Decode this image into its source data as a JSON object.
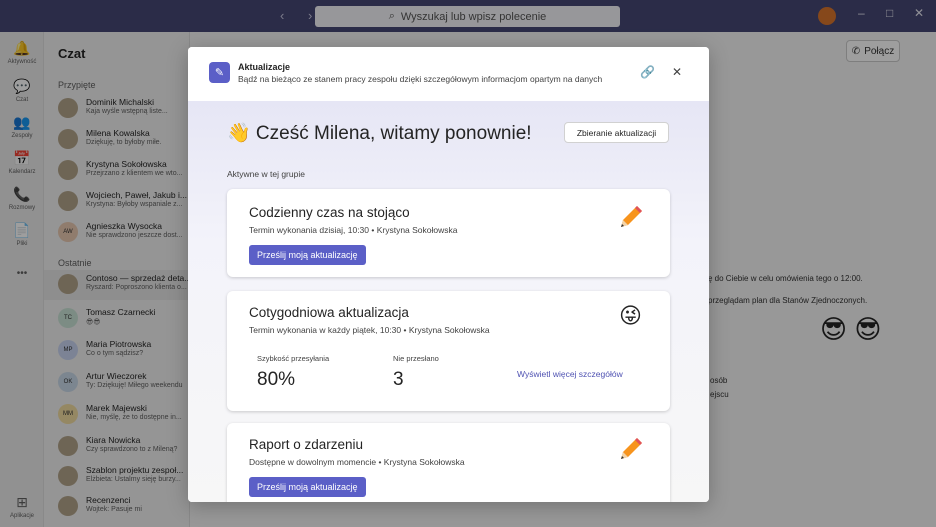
{
  "titlebar": {
    "nav_arrows": "‹ ›",
    "search_placeholder": "Wyszukaj lub wpisz polecenie",
    "minimize": "–",
    "maximize": "□",
    "close": "✕"
  },
  "rail": [
    {
      "icon": "bell-icon",
      "glyph": "🔔",
      "label": "Aktywność"
    },
    {
      "icon": "chat-icon",
      "glyph": "💬",
      "label": "Czat"
    },
    {
      "icon": "teams-icon",
      "glyph": "👥",
      "label": "Zespoły"
    },
    {
      "icon": "calendar-icon",
      "glyph": "📅",
      "label": "Kalendarz"
    },
    {
      "icon": "calls-icon",
      "glyph": "📞",
      "label": "Rozmowy"
    },
    {
      "icon": "files-icon",
      "glyph": "📄",
      "label": "Pliki"
    },
    {
      "icon": "more-icon",
      "glyph": "•••",
      "label": ""
    },
    {
      "icon": "apps-icon",
      "glyph": "⊞",
      "label": "Aplikacje"
    }
  ],
  "chatlist": {
    "title": "Czat",
    "pinned_label": "Przypięte",
    "recent_label": "Ostatnie",
    "pinned": [
      {
        "name": "Dominik Michalski",
        "preview": "Kaja wyśle wstępną liste...",
        "initials": ""
      },
      {
        "name": "Milena Kowalska",
        "preview": "Dziękuję, to byłoby miłe.",
        "initials": ""
      },
      {
        "name": "Krystyna Sokołowska",
        "preview": "Przejrzano z klientem we wto...",
        "initials": ""
      },
      {
        "name": "Wojciech, Paweł, Jakub i...",
        "preview": "Krystyna: Byłoby wspaniale z...",
        "initials": ""
      },
      {
        "name": "Agnieszka Wysocka",
        "preview": "Nie sprawdzono jeszcze dost...",
        "initials": "AW"
      }
    ],
    "recent": [
      {
        "name": "Contoso — sprzedaż deta...",
        "preview": "Ryszard: Poproszono klienta o...",
        "initials": ""
      },
      {
        "name": "Tomasz Czarnecki",
        "preview": "😎😎",
        "initials": "TC"
      },
      {
        "name": "Maria Piotrowska",
        "preview": "Co o tym sądzisz?",
        "initials": "MP"
      },
      {
        "name": "Artur Wieczorek",
        "preview": "Ty: Dziękuję! Miłego weekendu",
        "initials": "OK"
      },
      {
        "name": "Marek Majewski",
        "preview": "Nie, myślę, że to dostępne in...",
        "initials": "MM"
      },
      {
        "name": "Kiara Nowicka",
        "preview": "Czy sprawdzono to z Mileną?",
        "initials": ""
      },
      {
        "name": "Szablon projektu zespoł...",
        "preview": "Elżbieta: Ustalmy sieję burzy...",
        "initials": ""
      },
      {
        "name": "Recenzenci",
        "preview": "Wojtek: Pasuje mi",
        "initials": ""
      }
    ]
  },
  "main": {
    "call_label": "Połącz",
    "bg_msg_1": "ę do Ciebie w celu omówienia tego o 12:00.",
    "bg_msg_2": "przeglądam plan dla Stanów Zjednoczonych.",
    "bg_msg_3": "osób",
    "bg_msg_4": "ejscu",
    "bg_emoji": "😎 😎"
  },
  "modal": {
    "app_name": "Aktualizacje",
    "app_desc": "Bądź na bieżąco ze stanem pracy zespołu dzięki szczegółowym informacjom opartym na danych",
    "greeting": "👋 Cześć Milena, witamy ponownie!",
    "collect_button": "Zbieranie aktualizacji",
    "active_label": "Aktywne w tej grupie",
    "cards": [
      {
        "title": "Codzienny czas na stojąco",
        "subtitle": "Termin wykonania dzisiaj, 10:30 • Krystyna Sokołowska",
        "button": "Prześlij moją aktualizację",
        "icon": "pencil-icon"
      },
      {
        "title": "Cotygodniowa aktualizacja",
        "subtitle": "Termin wykonania w każdy piątek, 10:30 • Krystyna Sokołowska",
        "icon": "smiley-icon",
        "stat1_label": "Szybkość przesyłania",
        "stat1_value": "80%",
        "stat2_label": "Nie przesłano",
        "stat2_value": "3",
        "details_link": "Wyświetl więcej szczegółów"
      },
      {
        "title": "Raport o zdarzeniu",
        "subtitle": "Dostępne w dowolnym momencie • Krystyna Sokołowska",
        "button": "Prześlij moją aktualizację",
        "icon": "pencil-icon"
      }
    ]
  }
}
